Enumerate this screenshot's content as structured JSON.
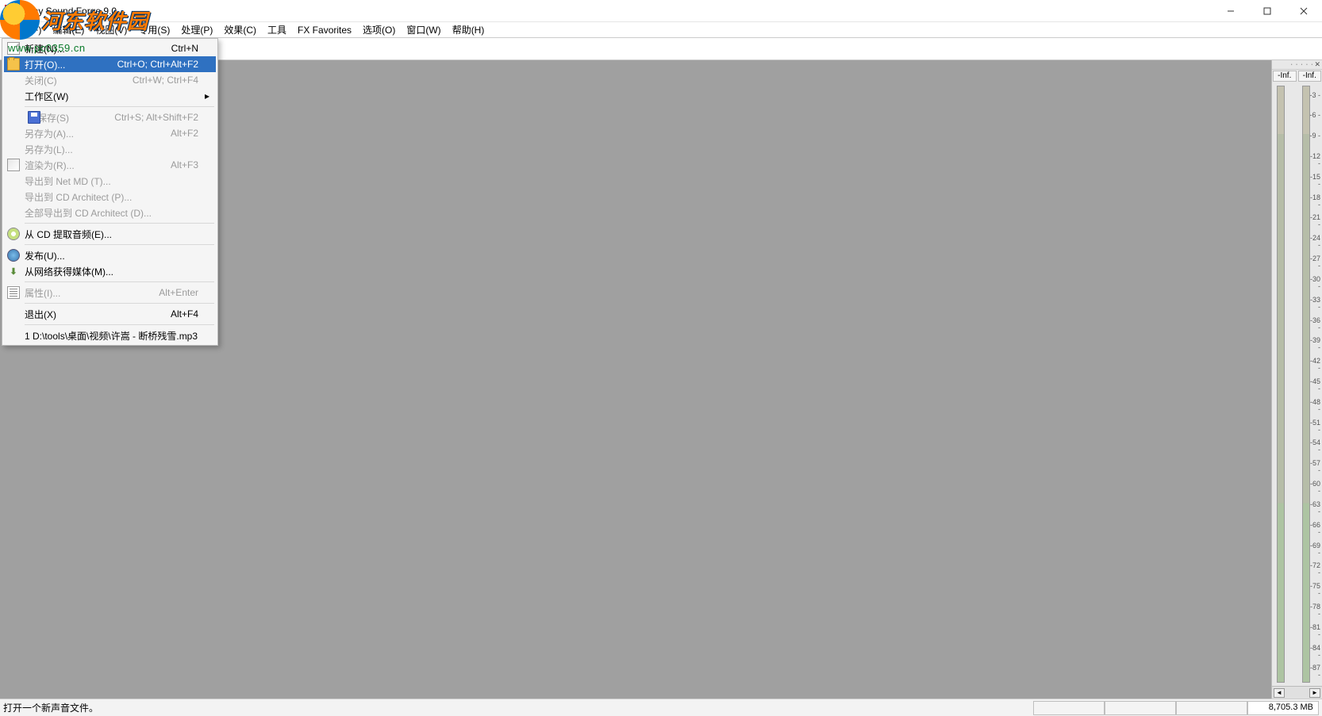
{
  "app_title": "Sony Sound Forge 9.0",
  "watermark": {
    "brand": "河东软件园",
    "url": "www.pc0359.cn"
  },
  "menubar": [
    "文件(F)",
    "编辑(E)",
    "视图(V)",
    "专用(S)",
    "处理(P)",
    "效果(C)",
    "工具",
    "FX Favorites",
    "选项(O)",
    "窗口(W)",
    "帮助(H)"
  ],
  "file_menu": [
    {
      "label": "新建(N)...",
      "shortcut": "Ctrl+N",
      "icon": "new",
      "type": "item",
      "disabled": false
    },
    {
      "label": "打开(O)...",
      "shortcut": "Ctrl+O; Ctrl+Alt+F2",
      "icon": "open",
      "type": "item",
      "selected": true
    },
    {
      "label": "关闭(C)",
      "shortcut": "Ctrl+W; Ctrl+F4",
      "type": "item",
      "disabled": true
    },
    {
      "label": "工作区(W)",
      "type": "sub"
    },
    {
      "type": "sep"
    },
    {
      "label": "保存(S)",
      "shortcut": "Ctrl+S; Alt+Shift+F2",
      "icon": "save",
      "type": "item",
      "disabled": true
    },
    {
      "label": "另存为(A)...",
      "shortcut": "Alt+F2",
      "type": "item",
      "disabled": true
    },
    {
      "label": "另存为(L)...",
      "type": "item",
      "disabled": true
    },
    {
      "label": "渲染为(R)...",
      "shortcut": "Alt+F3",
      "icon": "render",
      "type": "item",
      "disabled": true
    },
    {
      "label": "导出到 Net MD (T)...",
      "type": "item",
      "disabled": true
    },
    {
      "label": "导出到 CD Architect (P)...",
      "type": "item",
      "disabled": true
    },
    {
      "label": "全部导出到 CD Architect (D)...",
      "type": "item",
      "disabled": true
    },
    {
      "type": "sep"
    },
    {
      "label": "从 CD 提取音频(E)...",
      "icon": "cd",
      "type": "item"
    },
    {
      "type": "sep"
    },
    {
      "label": "发布(U)...",
      "icon": "globe",
      "type": "item"
    },
    {
      "label": "从网络获得媒体(M)...",
      "icon": "net",
      "type": "item"
    },
    {
      "type": "sep"
    },
    {
      "label": "属性(I)...",
      "shortcut": "Alt+Enter",
      "icon": "prop",
      "type": "item",
      "disabled": true
    },
    {
      "type": "sep"
    },
    {
      "label": "退出(X)",
      "shortcut": "Alt+F4",
      "type": "item"
    },
    {
      "type": "sep"
    },
    {
      "label": "1 D:\\tools\\桌面\\视频\\许嵩 - 断桥残雪.mp3",
      "type": "item"
    }
  ],
  "meter": {
    "label_left": "-Inf.",
    "label_right": "-Inf.",
    "ticks": [
      "3",
      "6",
      "9",
      "12",
      "15",
      "18",
      "21",
      "24",
      "27",
      "30",
      "33",
      "36",
      "39",
      "42",
      "45",
      "48",
      "51",
      "54",
      "57",
      "60",
      "63",
      "66",
      "69",
      "72",
      "75",
      "78",
      "81",
      "84",
      "87"
    ]
  },
  "status": {
    "text": "打开一个新声音文件。",
    "memory": "8,705.3 MB"
  }
}
